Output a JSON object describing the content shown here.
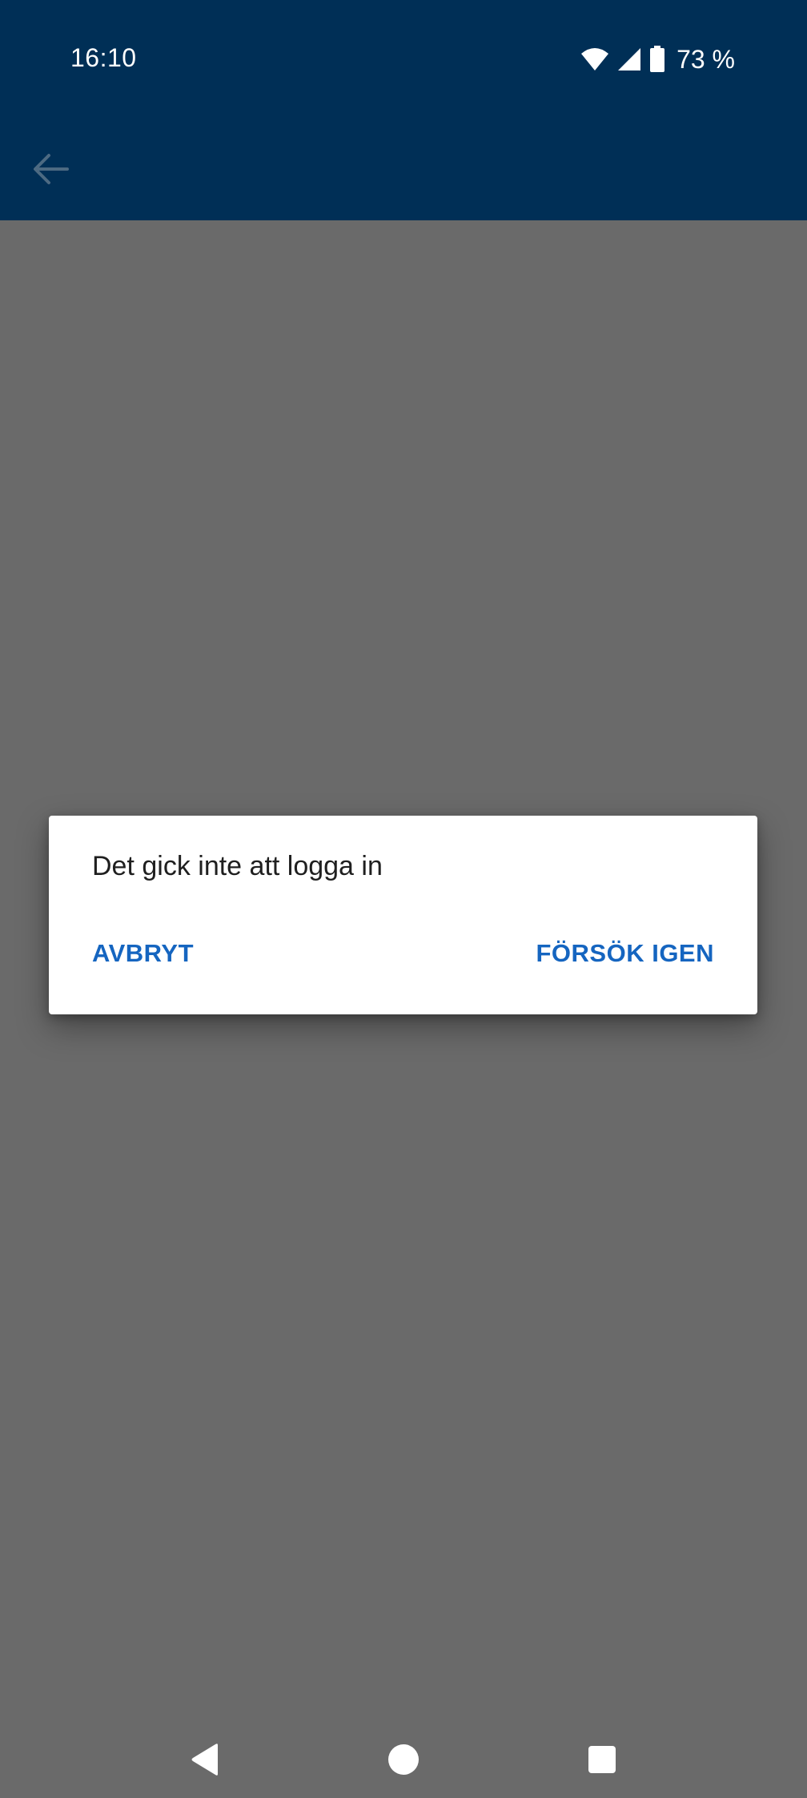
{
  "status_bar": {
    "time": "16:10",
    "battery_percent": "73 %",
    "icons": [
      "wifi-icon",
      "signal-icon",
      "battery-icon"
    ]
  },
  "app_bar": {
    "back_icon": "arrow-left-icon",
    "background_color": "#002f56"
  },
  "dialog": {
    "message": "Det gick inte att logga in",
    "cancel_label": "AVBRYT",
    "retry_label": "FÖRSÖK IGEN",
    "accent_color": "#1565c0"
  },
  "nav_bar": {
    "icons": [
      "nav-back-icon",
      "nav-home-icon",
      "nav-recents-icon"
    ]
  }
}
